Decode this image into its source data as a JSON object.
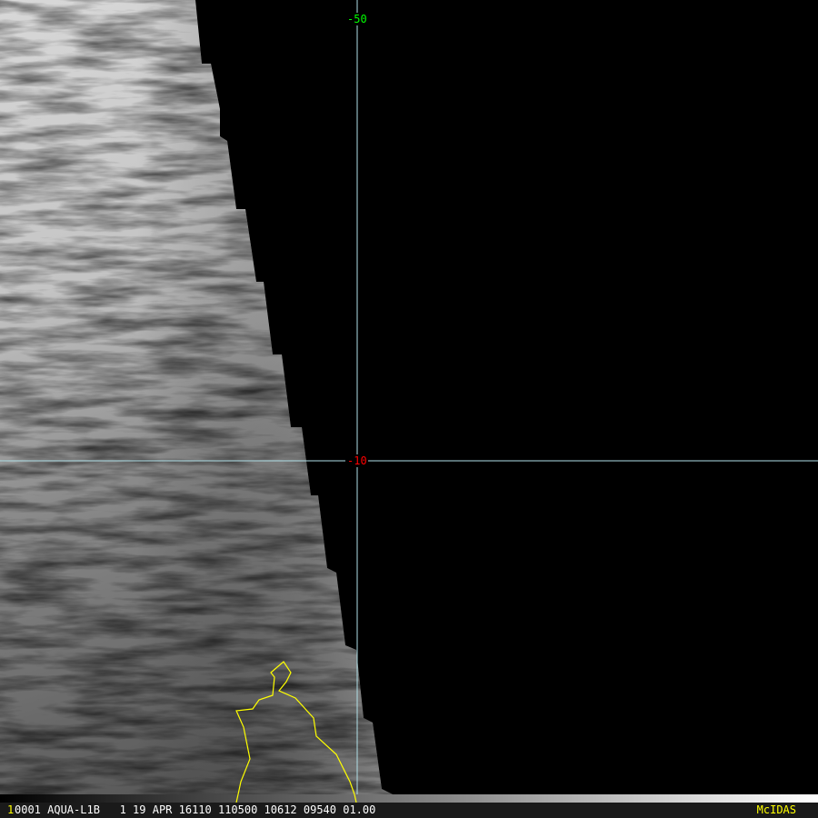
{
  "map": {
    "lat_label": "-50",
    "lon_label": "-10",
    "colors": {
      "grid": "#b0e0e8",
      "lat_label": "#00ff00",
      "lon_label": "#ff0000",
      "coastline": "#ffff00"
    }
  },
  "status_bar": {
    "frame": "1",
    "info": "0001 AQUA-L1B   1 19 APR 16110 110500 10612 09540 01.00",
    "brand": "McIDAS"
  }
}
